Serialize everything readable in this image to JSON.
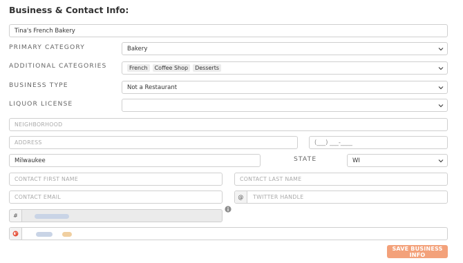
{
  "section": {
    "title": "Business & Contact Info:"
  },
  "business_name": {
    "value": "Tina's French Bakery"
  },
  "primary_category": {
    "label": "PRIMARY CATEGORY",
    "value": "Bakery"
  },
  "additional_categories": {
    "label": "ADDITIONAL CATEGORIES",
    "tags": [
      "French",
      "Coffee Shop",
      "Desserts"
    ]
  },
  "business_type": {
    "label": "BUSINESS TYPE",
    "value": "Not a Restaurant"
  },
  "liquor_license": {
    "label": "LIQUOR LICENSE",
    "value": ""
  },
  "neighborhood": {
    "placeholder": "NEIGHBORHOOD"
  },
  "address": {
    "placeholder": "ADDRESS"
  },
  "phone": {
    "mask": "(___) ___-____"
  },
  "city": {
    "value": "Milwaukee"
  },
  "state": {
    "label": "STATE",
    "value": "WI"
  },
  "contact_first_name": {
    "placeholder": "CONTACT FIRST NAME"
  },
  "contact_last_name": {
    "placeholder": "CONTACT LAST NAME"
  },
  "contact_email": {
    "placeholder": "CONTACT EMAIL"
  },
  "twitter": {
    "prefix": "@",
    "placeholder": "TWITTER HANDLE"
  },
  "id_field": {
    "prefix": "#"
  },
  "save_button": {
    "label": "SAVE BUSINESS INFO"
  },
  "colors": {
    "accent": "#f3a17a",
    "border": "#cfcfcf",
    "globe": "#e5533d"
  },
  "icons": {
    "chevron": "chevron-down-icon",
    "info": "info-icon",
    "globe": "globe-icon"
  }
}
